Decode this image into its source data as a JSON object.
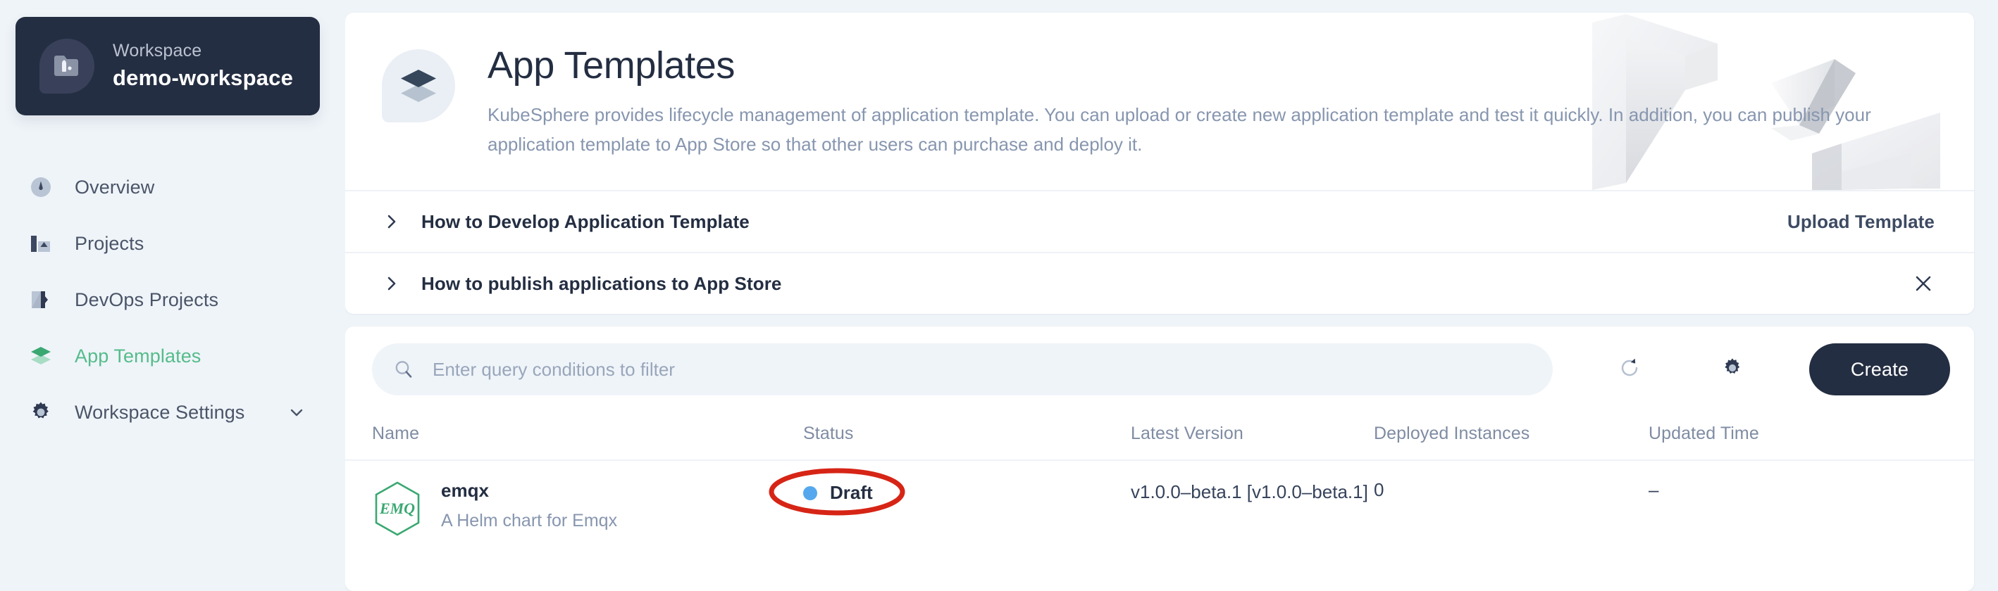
{
  "sidebar": {
    "workspace": {
      "label": "Workspace",
      "name": "demo-workspace",
      "icon": "workspace-folder-icon"
    },
    "items": [
      {
        "label": "Overview",
        "icon": "gauge-icon",
        "active": false,
        "chevron": false
      },
      {
        "label": "Projects",
        "icon": "projects-icon",
        "active": false,
        "chevron": false
      },
      {
        "label": "DevOps Projects",
        "icon": "devops-icon",
        "active": false,
        "chevron": false
      },
      {
        "label": "App Templates",
        "icon": "layers-icon",
        "active": true,
        "chevron": false
      },
      {
        "label": "Workspace Settings",
        "icon": "gear-icon",
        "active": false,
        "chevron": true
      }
    ]
  },
  "banner": {
    "icon": "layers-icon",
    "title": "App Templates",
    "description": "KubeSphere provides lifecycle management of application template. You can upload or create new application template and test it quickly. In addition, you can publish your application template to App Store so that other users can purchase and deploy it."
  },
  "collapsibles": [
    {
      "title": "How to Develop Application Template",
      "chevron_icon": "chevron-right-icon",
      "action_label": "Upload Template",
      "action_type": "link"
    },
    {
      "title": "How to publish applications to App Store",
      "chevron_icon": "chevron-right-icon",
      "action_label": "",
      "action_type": "close"
    }
  ],
  "toolbar": {
    "search_placeholder": "Enter query conditions to filter",
    "search_value": "",
    "search_icon": "search-icon",
    "refresh_icon": "refresh-icon",
    "settings_icon": "gear-icon",
    "create_label": "Create"
  },
  "table": {
    "columns": [
      "Name",
      "Status",
      "Latest Version",
      "Deployed Instances",
      "Updated Time"
    ],
    "rows": [
      {
        "logo_text": "EMQ",
        "name": "emqx",
        "description": "A Helm chart for Emqx",
        "status": "Draft",
        "status_color": "#55a8ed",
        "latest_version": "v1.0.0–beta.1 [v1.0.0–beta.1]",
        "deployed_instances": "0",
        "updated_time": "–",
        "annotated": true
      }
    ]
  },
  "colors": {
    "accent_green": "#55bc8a",
    "dark": "#242e42",
    "page_bg": "#eff4f9",
    "muted": "#8796af",
    "annotation_red": "#d62516"
  }
}
